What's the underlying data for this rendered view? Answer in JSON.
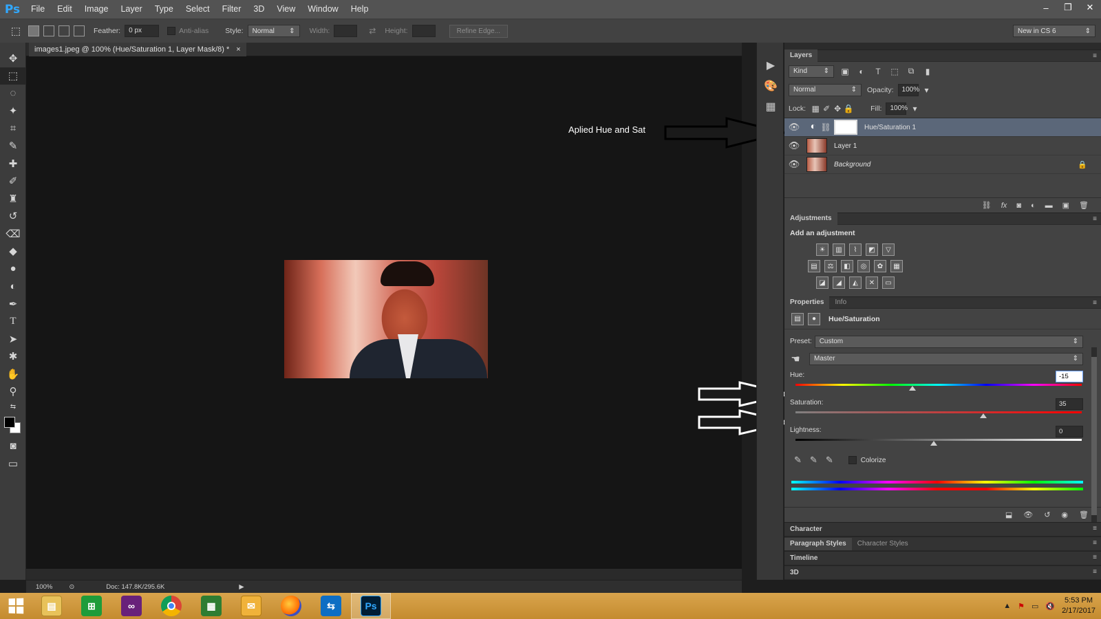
{
  "app": {
    "logo": "Ps",
    "menu": [
      "File",
      "Edit",
      "Image",
      "Layer",
      "Type",
      "Select",
      "Filter",
      "3D",
      "View",
      "Window",
      "Help"
    ],
    "window_controls": [
      "–",
      "❐",
      "✕"
    ]
  },
  "options_bar": {
    "feather_label": "Feather:",
    "feather_value": "0 px",
    "antialias_label": "Anti-alias",
    "style_label": "Style:",
    "style_value": "Normal",
    "width_label": "Width:",
    "height_label": "Height:",
    "refine_edge": "Refine Edge...",
    "workspace": "New in CS 6"
  },
  "document": {
    "tab_title": "images1.jpeg @ 100% (Hue/Saturation 1, Layer Mask/8) *",
    "tab_close": "×",
    "zoom": "100%",
    "doc_info": "Doc: 147.8K/295.6K"
  },
  "annotation": {
    "text": "Aplied Hue and Sat"
  },
  "layers_panel": {
    "title": "Layers",
    "kind_label": "Kind",
    "blend_mode": "Normal",
    "opacity_label": "Opacity:",
    "opacity_value": "100%",
    "lock_label": "Lock:",
    "fill_label": "Fill:",
    "fill_value": "100%",
    "layers": [
      {
        "name": "Hue/Saturation 1"
      },
      {
        "name": "Layer 1"
      },
      {
        "name": "Background"
      }
    ]
  },
  "adjustments_panel": {
    "title": "Adjustments",
    "subtitle": "Add an adjustment"
  },
  "properties_panel": {
    "tabs": [
      "Properties",
      "Info"
    ],
    "title": "Hue/Saturation",
    "preset_label": "Preset:",
    "preset_value": "Custom",
    "channel_value": "Master",
    "hue_label": "Hue:",
    "hue_value": "-15",
    "saturation_label": "Saturation:",
    "saturation_value": "35",
    "lightness_label": "Lightness:",
    "lightness_value": "0",
    "colorize_label": "Colorize"
  },
  "collapsed_panels": {
    "character": "Character",
    "paragraph_styles": "Paragraph Styles",
    "character_styles": "Character Styles",
    "timeline": "Timeline",
    "three_d": "3D"
  },
  "taskbar": {
    "time": "5:53 PM",
    "date": "2/17/2017"
  }
}
